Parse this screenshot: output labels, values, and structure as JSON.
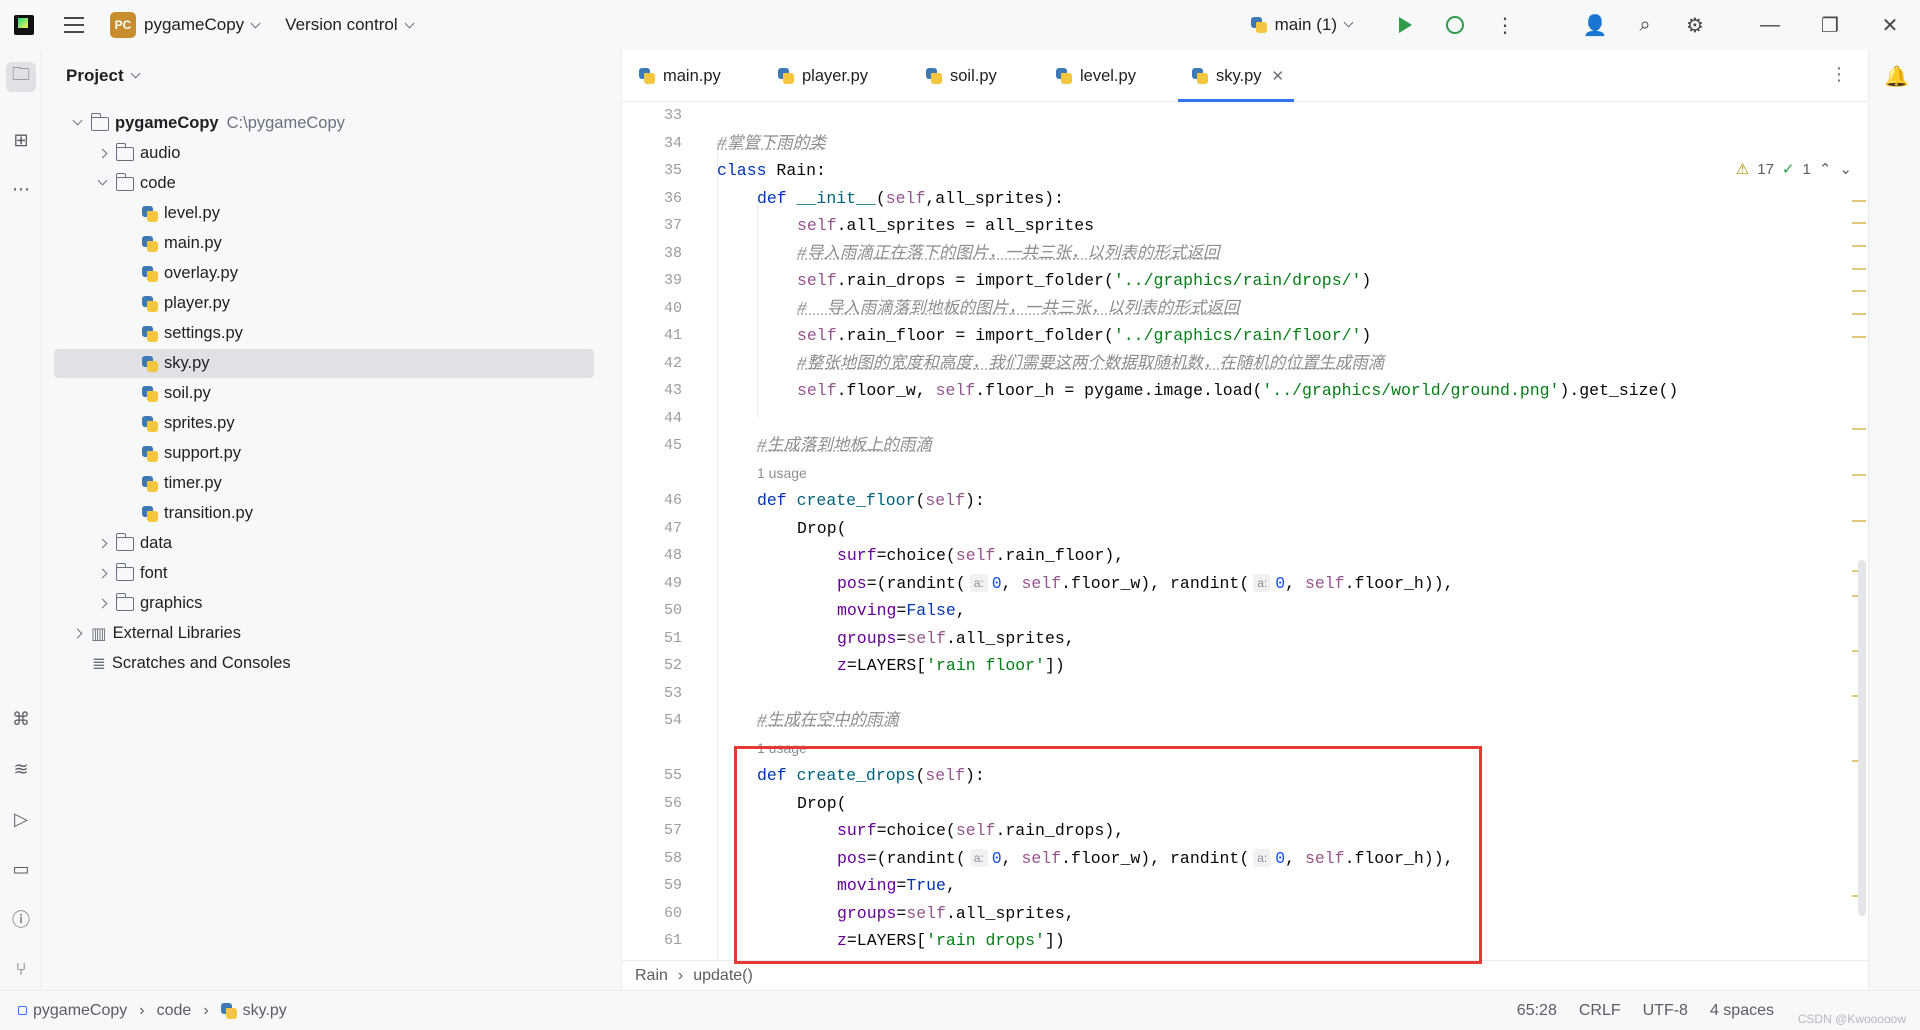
{
  "titlebar": {
    "project_badge": "PC",
    "project_name": "pygameCopy",
    "version_control": "Version control",
    "run_config": "main (1)"
  },
  "project_panel": {
    "title": "Project",
    "root_name": "pygameCopy",
    "root_path": "C:\\pygameCopy",
    "items": [
      {
        "label": "audio"
      },
      {
        "label": "code"
      },
      {
        "label": "level.py"
      },
      {
        "label": "main.py"
      },
      {
        "label": "overlay.py"
      },
      {
        "label": "player.py"
      },
      {
        "label": "settings.py"
      },
      {
        "label": "sky.py"
      },
      {
        "label": "soil.py"
      },
      {
        "label": "sprites.py"
      },
      {
        "label": "support.py"
      },
      {
        "label": "timer.py"
      },
      {
        "label": "transition.py"
      },
      {
        "label": "data"
      },
      {
        "label": "font"
      },
      {
        "label": "graphics"
      },
      {
        "label": "External Libraries"
      },
      {
        "label": "Scratches and Consoles"
      }
    ]
  },
  "tabs": [
    {
      "label": "main.py"
    },
    {
      "label": "player.py"
    },
    {
      "label": "soil.py"
    },
    {
      "label": "level.py"
    },
    {
      "label": "sky.py",
      "active": true
    }
  ],
  "inspections": {
    "warnings": "17",
    "weak": "1"
  },
  "editor": {
    "line_numbers": [
      "33",
      "34",
      "35",
      "36",
      "37",
      "38",
      "39",
      "40",
      "41",
      "42",
      "43",
      "44",
      "45",
      "46",
      "47",
      "48",
      "49",
      "50",
      "51",
      "52",
      "53",
      "54",
      "55",
      "56",
      "57",
      "58",
      "59",
      "60",
      "61"
    ],
    "usage_label": "1 usage",
    "comments": {
      "c34": "#掌管下雨的类",
      "c38": "#导入雨滴正在落下的图片，一共三张，以列表的形式返回",
      "c40": "#  导入雨滴落到地板的图片，一共三张，以列表的形式返回",
      "c42": "#整张地图的宽度和高度，我们需要这两个数据取随机数，在随机的位置生成雨滴",
      "c45": "#生成落到地板上的雨滴",
      "c54": "#生成在空中的雨滴"
    },
    "hint_a": "a:"
  },
  "code_breadcrumb": {
    "class": "Rain",
    "method": "update()"
  },
  "statusbar": {
    "project": "pygameCopy",
    "folder": "code",
    "file": "sky.py",
    "position": "65:28",
    "line_sep": "CRLF",
    "encoding": "UTF-8",
    "indent": "4 spaces",
    "watermark": "CSDN @Kwooooow"
  },
  "colors": {
    "accent": "#3574f0",
    "highlight_box": "#e53935"
  }
}
